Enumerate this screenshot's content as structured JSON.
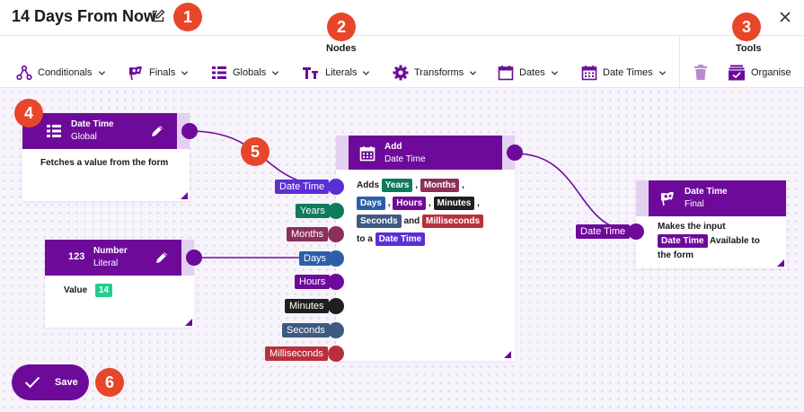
{
  "header": {
    "title": "14 Days From Now"
  },
  "badges": [
    "1",
    "2",
    "3",
    "4",
    "5",
    "6"
  ],
  "toolbar": {
    "nodes_title": "Nodes",
    "tools_title": "Tools",
    "menus": [
      "Conditionals",
      "Finals",
      "Globals",
      "Literals",
      "Transforms",
      "Dates",
      "Date Times"
    ],
    "organise_label": "Organise"
  },
  "nodes": {
    "global": {
      "name": "Date Time",
      "kind": "Global",
      "body": "Fetches a value from the form"
    },
    "number": {
      "icon_text": "123",
      "name": "Number",
      "kind": "Literal",
      "value_label": "Value",
      "value": "14"
    },
    "add": {
      "name": "Add",
      "kind": "Date Time",
      "inputs": [
        "Date Time",
        "Years",
        "Months",
        "Days",
        "Hours",
        "Minutes",
        "Seconds",
        "Milliseconds"
      ],
      "text_adds": "Adds",
      "text_comma": ",",
      "text_and": "and",
      "text_to_a": "to a"
    },
    "final": {
      "name": "Date Time",
      "kind": "Final",
      "input": "Date Time",
      "text_1": "Makes the input",
      "chip": "Date Time",
      "text_2": "Available to",
      "text_3": "the form"
    }
  },
  "colors": {
    "accent": "#6e0a9a",
    "datetime": "#5a2fd4",
    "years": "#0f7a5c",
    "months": "#8c2f5a",
    "days": "#2d5fa8",
    "hours": "#6e0a9a",
    "minutes": "#1f1f1f",
    "seconds": "#3e5a80",
    "milliseconds": "#b8303c",
    "number": "#1fd08f",
    "badge": "#e8462b"
  },
  "save": {
    "label": "Save"
  }
}
